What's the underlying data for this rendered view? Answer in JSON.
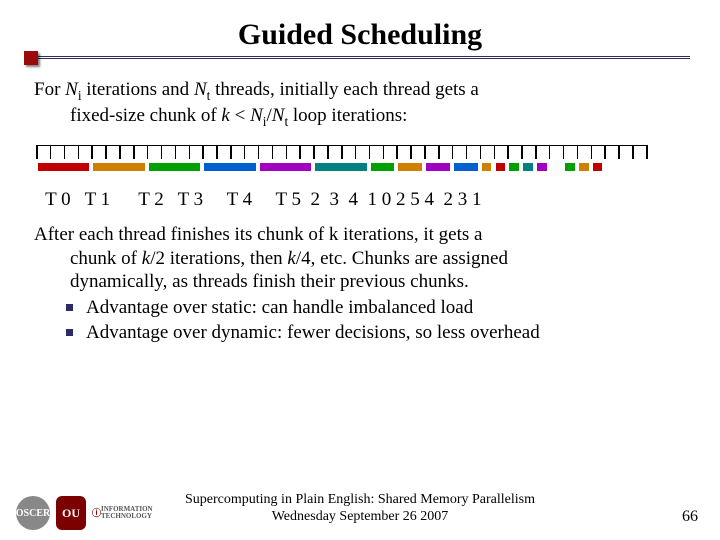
{
  "title": "Guided Scheduling",
  "intro_line1_a": "For ",
  "intro_Ni": "N",
  "intro_i": "i",
  "intro_line1_b": " iterations and ",
  "intro_Nt": "N",
  "intro_t": "t",
  "intro_line1_c": " threads, initially each thread gets a",
  "intro_line2_a": "fixed-size chunk of ",
  "intro_k": "k",
  "intro_line2_b": " < ",
  "intro_Ni2": "N",
  "intro_i2": "i",
  "intro_slash": "/",
  "intro_Nt2": "N",
  "intro_t2": "t",
  "intro_line2_c": " loop iterations:",
  "diagram": {
    "ticks": 44,
    "chunks": [
      {
        "start": 0,
        "len": 4,
        "color": "#c00000"
      },
      {
        "start": 4,
        "len": 4,
        "color": "#d08000"
      },
      {
        "start": 8,
        "len": 4,
        "color": "#00a000"
      },
      {
        "start": 12,
        "len": 4,
        "color": "#0060d0"
      },
      {
        "start": 16,
        "len": 4,
        "color": "#a000c0"
      },
      {
        "start": 20,
        "len": 4,
        "color": "#008080"
      },
      {
        "start": 24,
        "len": 2,
        "color": "#00a000"
      },
      {
        "start": 26,
        "len": 2,
        "color": "#d08000"
      },
      {
        "start": 28,
        "len": 2,
        "color": "#a000c0"
      },
      {
        "start": 30,
        "len": 2,
        "color": "#0060d0"
      },
      {
        "start": 32,
        "len": 1,
        "color": "#d08000"
      },
      {
        "start": 33,
        "len": 1,
        "color": "#c00000"
      },
      {
        "start": 34,
        "len": 1,
        "color": "#00a000"
      },
      {
        "start": 35,
        "len": 1,
        "color": "#008080"
      },
      {
        "start": 36,
        "len": 1,
        "color": "#a000c0"
      },
      {
        "start": 38,
        "len": 1,
        "color": "#00a000"
      },
      {
        "start": 39,
        "len": 1,
        "color": "#d08000"
      },
      {
        "start": 40,
        "len": 1,
        "color": "#c00000"
      }
    ],
    "labels": "  T 0   T 1      T 2   T 3     T 4     T 5  2  3  4  1 0 2 5 4  2 3 1"
  },
  "after_a": "After each thread finishes its chunk of k iterations, it gets a",
  "after_b": "chunk of ",
  "after_k2": "k",
  "after_b2": "/2 iterations, then ",
  "after_k4": "k",
  "after_b3": "/4, etc. Chunks are assigned",
  "after_c": "dynamically, as threads finish their previous chunks.",
  "bullet1": "Advantage over static: can handle imbalanced load",
  "bullet2": "Advantage over dynamic: fewer decisions, so less overhead",
  "footer1": "Supercomputing in Plain English: Shared Memory Parallelism",
  "footer2": "Wednesday September 26 2007",
  "pagenum": "66",
  "logos": {
    "oscer": "OSCER",
    "ou": "OU",
    "it": "IT"
  }
}
